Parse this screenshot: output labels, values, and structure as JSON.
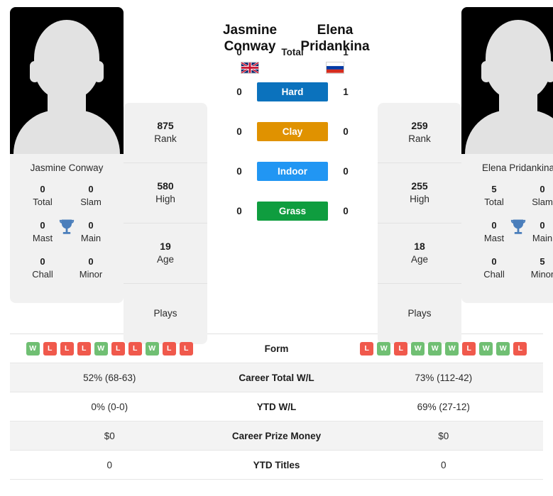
{
  "players": {
    "left": {
      "first_name": "Jasmine",
      "last_name": "Conway",
      "full_name": "Jasmine Conway",
      "country_flag": "gb-flag-icon",
      "avatar": "player-silhouette-avatar",
      "titles": {
        "total_value": "0",
        "total_label": "Total",
        "slam_value": "0",
        "slam_label": "Slam",
        "mast_value": "0",
        "mast_label": "Mast",
        "main_value": "0",
        "main_label": "Main",
        "chall_value": "0",
        "chall_label": "Chall",
        "minor_value": "0",
        "minor_label": "Minor"
      },
      "stats": [
        {
          "value": "875",
          "label": "Rank"
        },
        {
          "value": "580",
          "label": "High"
        },
        {
          "value": "19",
          "label": "Age"
        },
        {
          "value": "",
          "label": "Plays"
        }
      ],
      "form": [
        "W",
        "L",
        "L",
        "L",
        "W",
        "L",
        "L",
        "W",
        "L",
        "L"
      ]
    },
    "right": {
      "first_name": "Elena",
      "last_name": "Pridankina",
      "full_name": "Elena Pridankina",
      "country_flag": "ru-flag-icon",
      "avatar": "player-silhouette-avatar",
      "titles": {
        "total_value": "5",
        "total_label": "Total",
        "slam_value": "0",
        "slam_label": "Slam",
        "mast_value": "0",
        "mast_label": "Mast",
        "main_value": "0",
        "main_label": "Main",
        "chall_value": "0",
        "chall_label": "Chall",
        "minor_value": "5",
        "minor_label": "Minor"
      },
      "stats": [
        {
          "value": "259",
          "label": "Rank"
        },
        {
          "value": "255",
          "label": "High"
        },
        {
          "value": "18",
          "label": "Age"
        },
        {
          "value": "",
          "label": "Plays"
        }
      ],
      "form": [
        "L",
        "W",
        "L",
        "W",
        "W",
        "W",
        "L",
        "W",
        "W",
        "L"
      ]
    }
  },
  "head_to_head": {
    "rows": [
      {
        "label": "Total",
        "left": "0",
        "right": "1",
        "badge": false,
        "color": ""
      },
      {
        "label": "Hard",
        "left": "0",
        "right": "1",
        "badge": true,
        "color": "#0b72bd"
      },
      {
        "label": "Clay",
        "left": "0",
        "right": "0",
        "badge": true,
        "color": "#e09200"
      },
      {
        "label": "Indoor",
        "left": "0",
        "right": "0",
        "badge": true,
        "color": "#2196f3"
      },
      {
        "label": "Grass",
        "left": "0",
        "right": "0",
        "badge": true,
        "color": "#0f9d3f"
      }
    ]
  },
  "stats_table": {
    "form_label": "Form",
    "rows": [
      {
        "label": "Career Total W/L",
        "left": "52% (68-63)",
        "right": "73% (112-42)"
      },
      {
        "label": "YTD W/L",
        "left": "0% (0-0)",
        "right": "69% (27-12)"
      },
      {
        "label": "Career Prize Money",
        "left": "$0",
        "right": "$0"
      },
      {
        "label": "YTD Titles",
        "left": "0",
        "right": "0"
      }
    ]
  },
  "colors": {
    "form_win": "#70bf73",
    "form_loss": "#f0594c",
    "trophy": "#4a7ebb",
    "card_bg": "#f1f1f1",
    "row_alt": "#f3f3f3"
  }
}
